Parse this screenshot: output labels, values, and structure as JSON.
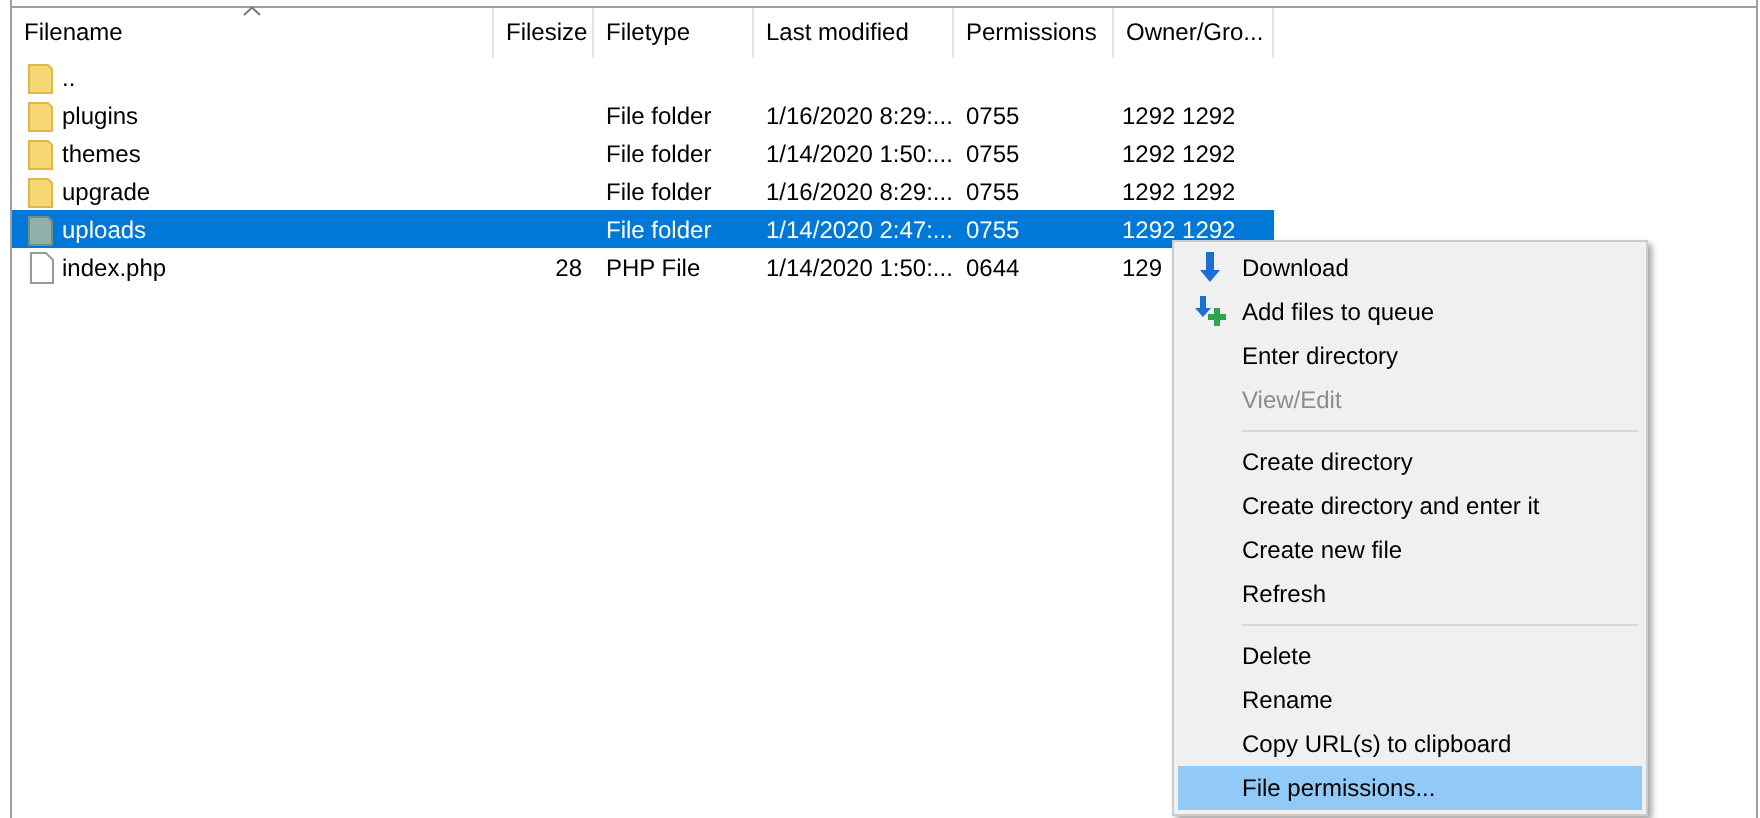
{
  "table": {
    "columns": [
      {
        "label": "Filename",
        "sorted": true
      },
      {
        "label": "Filesize",
        "sorted": false
      },
      {
        "label": "Filetype",
        "sorted": false
      },
      {
        "label": "Last modified",
        "sorted": false
      },
      {
        "label": "Permissions",
        "sorted": false
      },
      {
        "label": "Owner/Gro...",
        "sorted": false
      }
    ],
    "rows": [
      {
        "kind": "folder",
        "name": "..",
        "size": "",
        "type": "",
        "modified": "",
        "permissions": "",
        "owner": "",
        "selected": false
      },
      {
        "kind": "folder",
        "name": "plugins",
        "size": "",
        "type": "File folder",
        "modified": "1/16/2020 8:29:...",
        "permissions": "0755",
        "owner": "1292 1292",
        "selected": false
      },
      {
        "kind": "folder",
        "name": "themes",
        "size": "",
        "type": "File folder",
        "modified": "1/14/2020 1:50:...",
        "permissions": "0755",
        "owner": "1292 1292",
        "selected": false
      },
      {
        "kind": "folder",
        "name": "upgrade",
        "size": "",
        "type": "File folder",
        "modified": "1/16/2020 8:29:...",
        "permissions": "0755",
        "owner": "1292 1292",
        "selected": false
      },
      {
        "kind": "folder",
        "name": "uploads",
        "size": "",
        "type": "File folder",
        "modified": "1/14/2020 2:47:...",
        "permissions": "0755",
        "owner": "1292 1292",
        "selected": true
      },
      {
        "kind": "file",
        "name": "index.php",
        "size": "28",
        "type": "PHP File",
        "modified": "1/14/2020 1:50:...",
        "permissions": "0644",
        "owner": "129",
        "selected": false
      }
    ]
  },
  "context_menu": {
    "items": [
      {
        "kind": "item",
        "label": "Download",
        "disabled": false,
        "selected": false
      },
      {
        "kind": "item",
        "label": "Add files to queue",
        "disabled": false,
        "selected": false
      },
      {
        "kind": "item",
        "label": "Enter directory",
        "disabled": false,
        "selected": false
      },
      {
        "kind": "item",
        "label": "View/Edit",
        "disabled": true,
        "selected": false
      },
      {
        "kind": "separator"
      },
      {
        "kind": "item",
        "label": "Create directory",
        "disabled": false,
        "selected": false
      },
      {
        "kind": "item",
        "label": "Create directory and enter it",
        "disabled": false,
        "selected": false
      },
      {
        "kind": "item",
        "label": "Create new file",
        "disabled": false,
        "selected": false
      },
      {
        "kind": "item",
        "label": "Refresh",
        "disabled": false,
        "selected": false
      },
      {
        "kind": "separator"
      },
      {
        "kind": "item",
        "label": "Delete",
        "disabled": false,
        "selected": false
      },
      {
        "kind": "item",
        "label": "Rename",
        "disabled": false,
        "selected": false
      },
      {
        "kind": "item",
        "label": "Copy URL(s) to clipboard",
        "disabled": false,
        "selected": false
      },
      {
        "kind": "item",
        "label": "File permissions...",
        "disabled": false,
        "selected": true
      }
    ]
  }
}
